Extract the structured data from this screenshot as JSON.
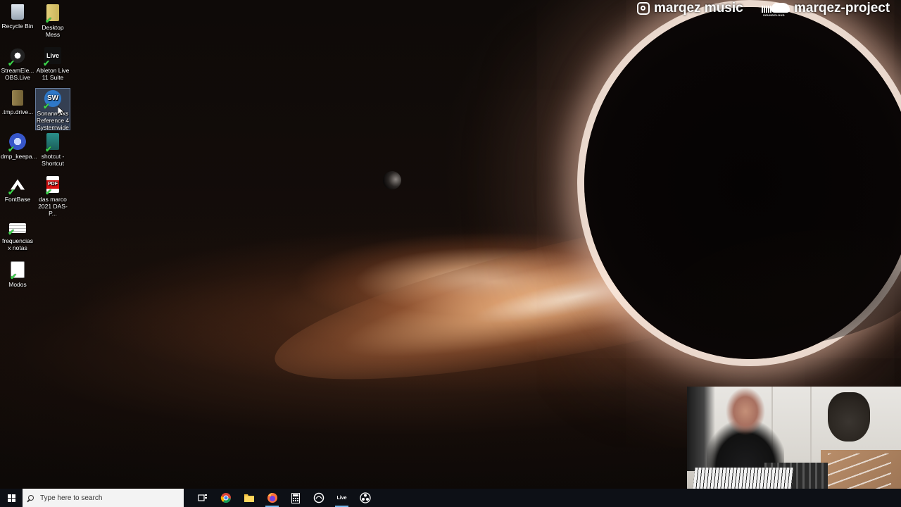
{
  "desktop": {
    "icons": [
      {
        "label": "Recycle Bin",
        "icon": "recycle-bin-icon"
      },
      {
        "label": "Desktop Mess",
        "icon": "folder-archive-icon"
      },
      {
        "label": "StreamEle... OBS.Live",
        "icon": "streamelements-icon"
      },
      {
        "label": "Ableton Live 11 Suite",
        "icon": "ableton-live-icon",
        "glyph": "Live"
      },
      {
        "label": ".tmp.drive...",
        "icon": "tmp-drive-icon"
      },
      {
        "label": "Sonarworks Reference 4 Systemwide",
        "icon": "sonarworks-icon",
        "glyph": "SW"
      },
      {
        "label": "dmp_keepa...",
        "icon": "keepass-icon"
      },
      {
        "label": "shotcut - Shortcut",
        "icon": "shotcut-icon"
      },
      {
        "label": "FontBase",
        "icon": "fontbase-icon"
      },
      {
        "label": "das marco 2021 DAS-P...",
        "icon": "pdf-file-icon",
        "glyph": "PDF"
      },
      {
        "label": "frequencias x notas",
        "icon": "spreadsheet-icon"
      },
      {
        "label": "Modos",
        "icon": "document-icon"
      }
    ]
  },
  "overlay": {
    "instagram": "marqez music",
    "soundcloud": "marqez-project",
    "soundcloud_mark": "SOUNDCLOUD"
  },
  "taskbar": {
    "search_placeholder": "Type here to search",
    "apps": [
      {
        "name": "Task View",
        "icon": "task-view-icon"
      },
      {
        "name": "Google Chrome",
        "icon": "chrome-icon"
      },
      {
        "name": "File Explorer",
        "icon": "file-explorer-icon"
      },
      {
        "name": "Firefox",
        "icon": "firefox-icon"
      },
      {
        "name": "Calculator",
        "icon": "calculator-icon"
      },
      {
        "name": "Sonarworks",
        "icon": "sonarworks-taskbar-icon"
      },
      {
        "name": "Ableton Live",
        "icon": "ableton-taskbar-icon",
        "glyph": "Live"
      },
      {
        "name": "OBS",
        "icon": "obs-icon"
      }
    ]
  },
  "colors": {
    "taskbar_bg": "#0d1016",
    "search_bg": "#f3f3f3",
    "active_indicator": "#76b9ed"
  }
}
